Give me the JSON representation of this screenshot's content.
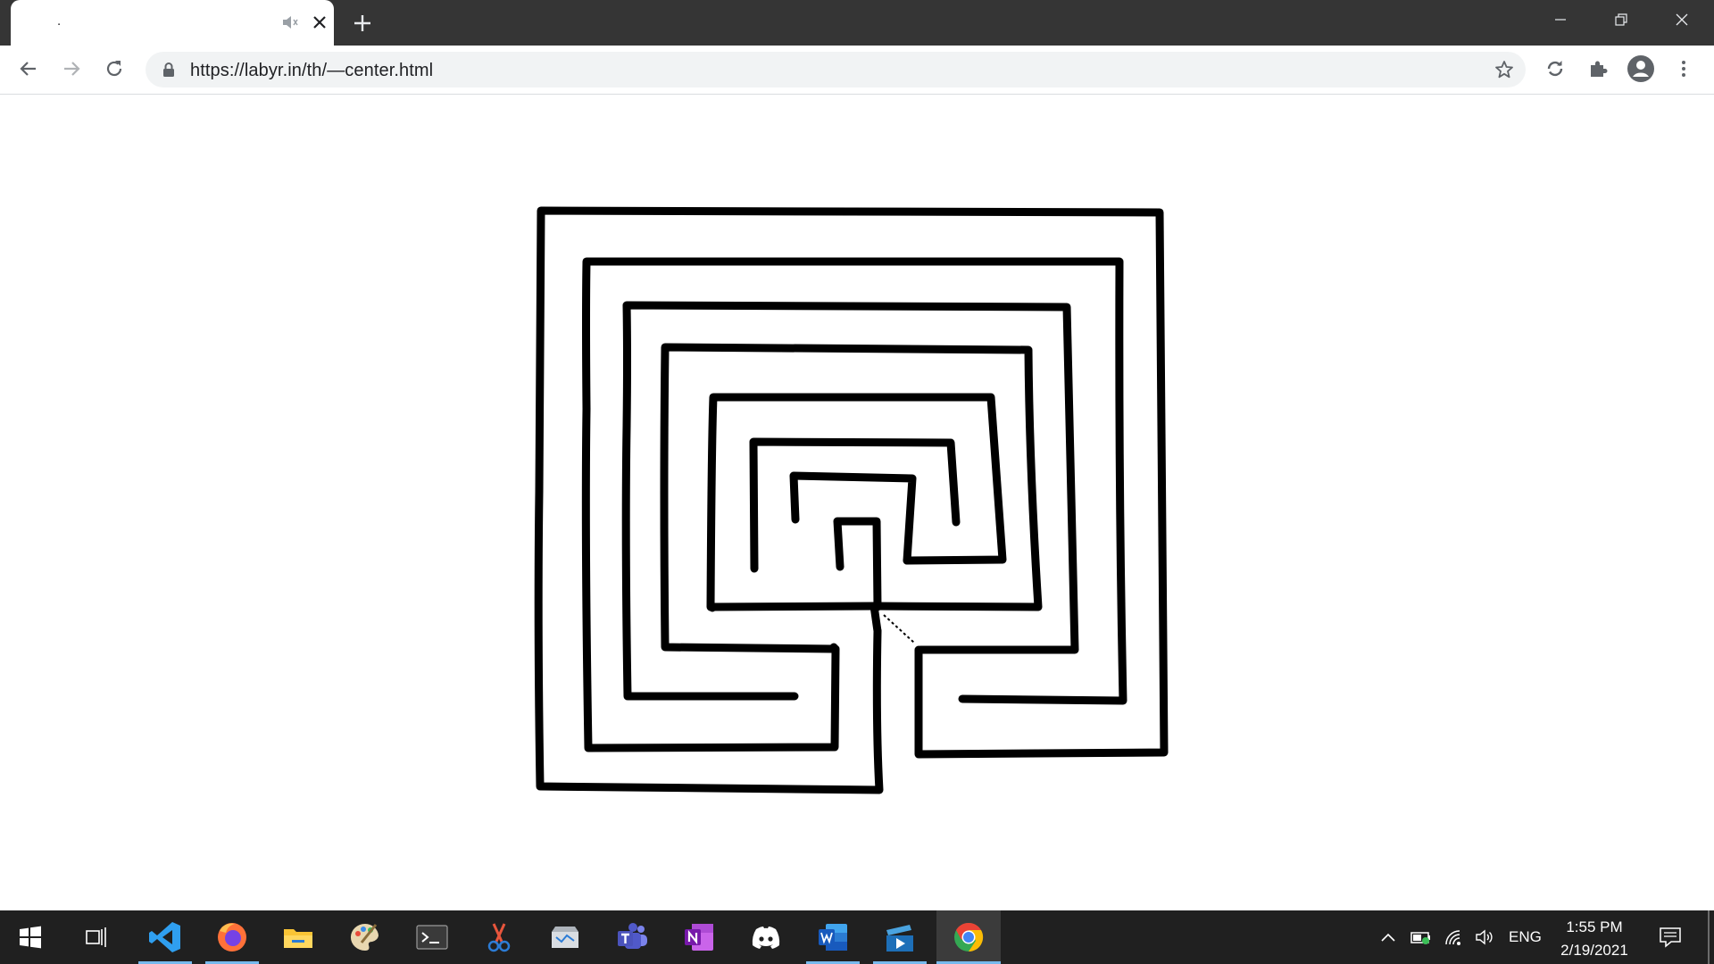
{
  "browser": {
    "tab": {
      "title": ".",
      "audio_icon": "speaker-muted-icon",
      "close_icon": "close-icon"
    },
    "new_tab_icon": "plus-icon",
    "window_controls": [
      "minimize-icon",
      "restore-icon",
      "close-icon"
    ],
    "toolbar": {
      "back_icon": "arrow-left-icon",
      "forward_icon": "arrow-right-icon",
      "reload_icon": "reload-icon",
      "url": "https://labyr.in/th/—center.html",
      "lock_icon": "lock-icon",
      "bookmark_icon": "star-icon",
      "extension_icons": [
        "sync-icon",
        "puzzle-icon",
        "profile-icon",
        "menu-icon"
      ]
    }
  },
  "page": {
    "content": "hand-drawn labyrinth",
    "stroke_color": "#000000",
    "background_color": "#ffffff"
  },
  "taskbar": {
    "apps": [
      "windows-start-icon",
      "task-view-icon",
      "vscode-icon",
      "firefox-icon",
      "file-explorer-icon",
      "paint-icon",
      "terminal-icon",
      "snipping-tool-icon",
      "scanner-icon",
      "teams-icon",
      "onenote-icon",
      "discord-icon",
      "word-icon",
      "video-player-icon",
      "chrome-icon"
    ],
    "tray": {
      "language": "ENG",
      "time": "1:55 PM",
      "date": "2/19/2021"
    }
  }
}
